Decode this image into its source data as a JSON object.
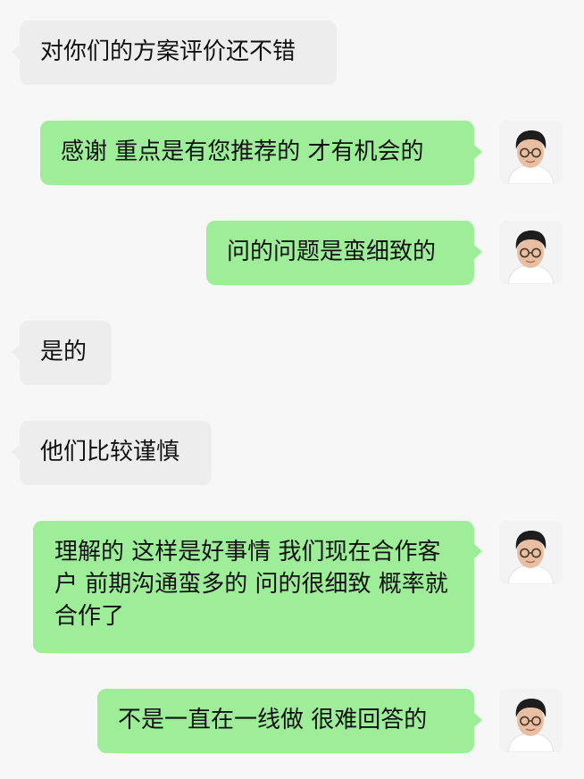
{
  "messages": [
    {
      "side": "in",
      "text": "对你们的方案评价还不错"
    },
    {
      "side": "out",
      "text": "感谢 重点是有您推荐的 才有机会的"
    },
    {
      "side": "out",
      "text": "问的问题是蛮细致的"
    },
    {
      "side": "in",
      "text": "是的"
    },
    {
      "side": "in",
      "text": "他们比较谨慎"
    },
    {
      "side": "out",
      "text": "理解的 这样是好事情 我们现在合作客户 前期沟通蛮多的 问的很细致 概率就合作了"
    },
    {
      "side": "out",
      "text": "不是一直在一线做 很难回答的"
    }
  ],
  "colors": {
    "background": "#f7f7f7",
    "incoming_bubble": "#ededed",
    "outgoing_bubble": "#9ded99"
  },
  "avatar_icon": "user-photo-avatar"
}
